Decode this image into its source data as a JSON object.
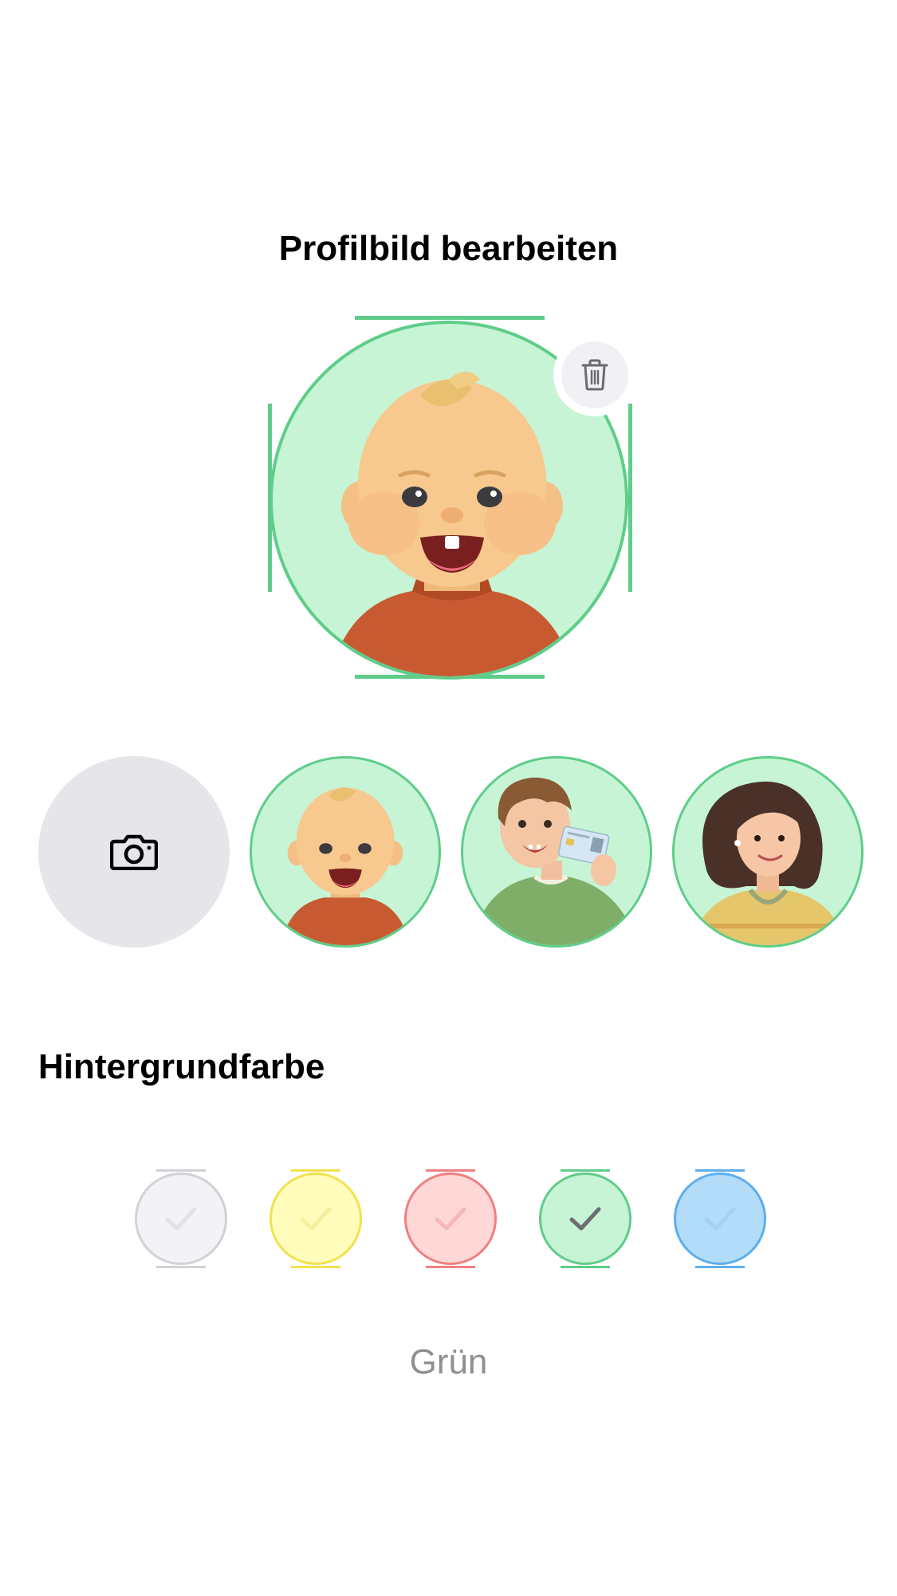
{
  "header": {
    "title": "Profilbild bearbeiten"
  },
  "main_avatar": {
    "character": "baby",
    "background_color": "#c6f4d5",
    "border_color": "#5fcd89",
    "delete_icon": "trash-icon"
  },
  "avatar_options": [
    {
      "type": "camera",
      "icon": "camera-icon"
    },
    {
      "type": "avatar",
      "character": "baby"
    },
    {
      "type": "avatar",
      "character": "boy-with-id-card"
    },
    {
      "type": "avatar",
      "character": "woman"
    }
  ],
  "background_section": {
    "title": "Hintergrundfarbe",
    "swatches": [
      {
        "name": "Grau",
        "fill": "#f2f2f7",
        "stroke": "#d1d1d6"
      },
      {
        "name": "Gelb",
        "fill": "#fffcbc",
        "stroke": "#f3e14e"
      },
      {
        "name": "Rot",
        "fill": "#ffd7d7",
        "stroke": "#f08080"
      },
      {
        "name": "Grün",
        "fill": "#c6f4d5",
        "stroke": "#5fcd89"
      },
      {
        "name": "Blau",
        "fill": "#b3dcf8",
        "stroke": "#5eaeec"
      }
    ],
    "selected_index": 3,
    "selected_label": "Grün"
  }
}
